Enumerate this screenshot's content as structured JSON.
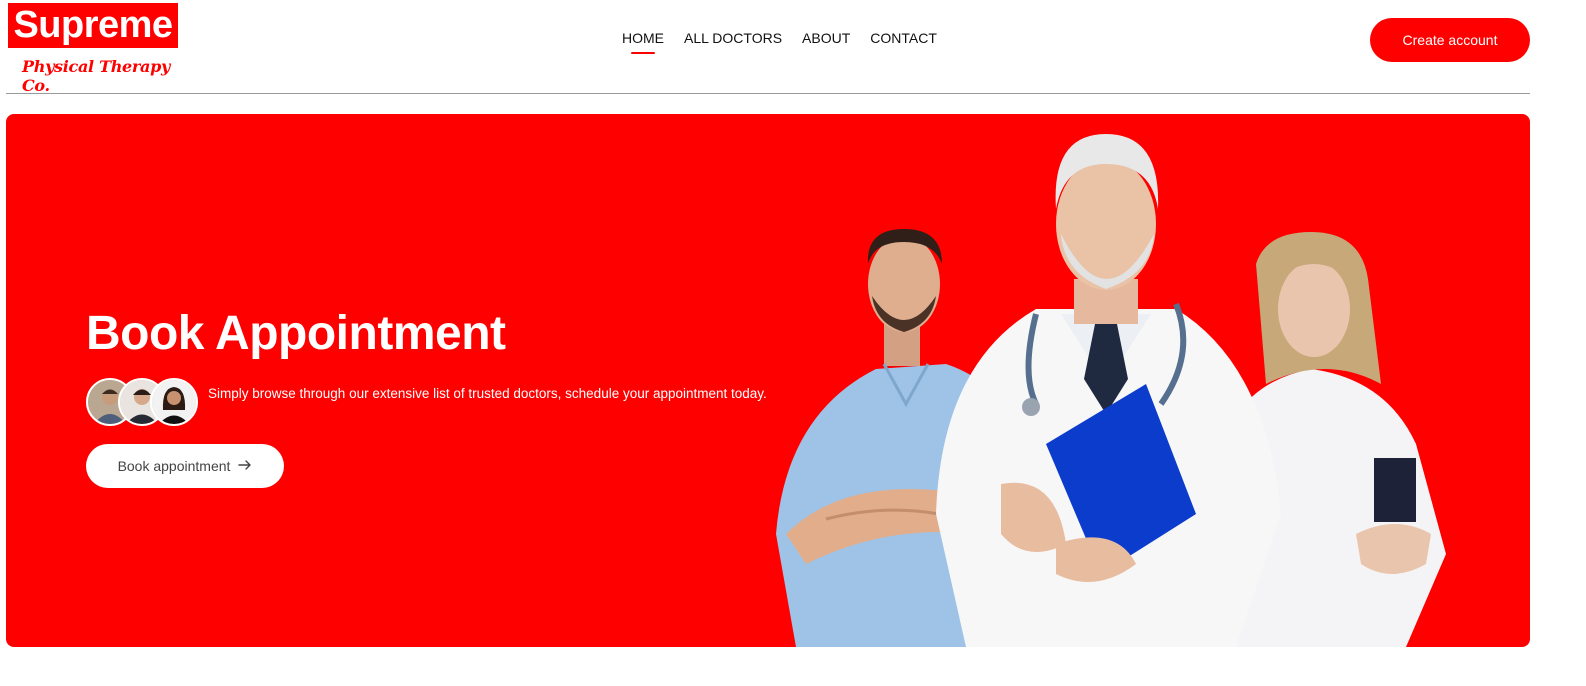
{
  "header": {
    "logo_title": "Supreme",
    "logo_subtitle": "Physical Therapy Co.",
    "nav": [
      {
        "label": "HOME",
        "active": true
      },
      {
        "label": "ALL DOCTORS",
        "active": false
      },
      {
        "label": "ABOUT",
        "active": false
      },
      {
        "label": "CONTACT",
        "active": false
      }
    ],
    "create_account_label": "Create account"
  },
  "hero": {
    "title": "Book Appointment",
    "description": "Simply browse through our extensive list of trusted doctors, schedule your appointment today.",
    "book_button_label": "Book appointment",
    "book_button_icon": "arrow-right-icon"
  },
  "colors": {
    "brand": "#ff0000",
    "text": "#111111",
    "white": "#ffffff"
  }
}
